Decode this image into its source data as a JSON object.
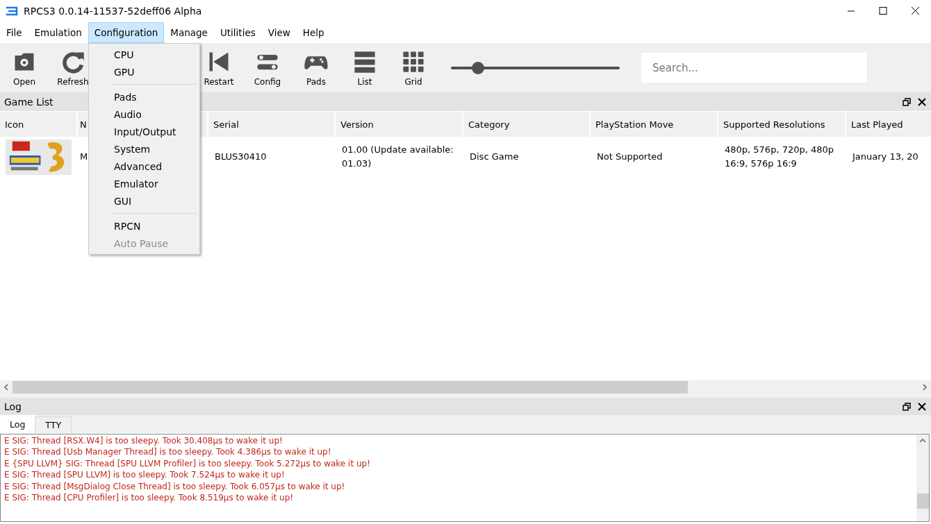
{
  "window": {
    "title": "RPCS3 0.0.14-11537-52deff06 Alpha"
  },
  "menubar": [
    {
      "label": "File",
      "selected": false
    },
    {
      "label": "Emulation",
      "selected": false
    },
    {
      "label": "Configuration",
      "selected": true
    },
    {
      "label": "Manage",
      "selected": false
    },
    {
      "label": "Utilities",
      "selected": false
    },
    {
      "label": "View",
      "selected": false
    },
    {
      "label": "Help",
      "selected": false
    }
  ],
  "toolbar": {
    "left": [
      {
        "label": "Open"
      },
      {
        "label": "Refresh"
      }
    ],
    "right": [
      {
        "label": "Restart"
      },
      {
        "label": "Config"
      },
      {
        "label": "Pads"
      },
      {
        "label": "List"
      },
      {
        "label": "Grid"
      }
    ],
    "zoom": {
      "level": 0.16
    },
    "search": {
      "placeholder": "Search..."
    }
  },
  "game_list": {
    "title": "Game List",
    "columns": [
      "Icon",
      "N",
      "Serial",
      "Version",
      "Category",
      "PlayStation Move",
      "Supported Resolutions",
      "Last Played"
    ],
    "rows": [
      {
        "cells": [
          {
            "kind": "picture"
          },
          {
            "kind": "text",
            "text": "M"
          },
          {
            "kind": "text",
            "text": "BLUS30410"
          },
          {
            "kind": "text",
            "text": "01.00 (Update available: 01.03)"
          },
          {
            "kind": "text",
            "text": "Disc Game"
          },
          {
            "kind": "text",
            "text": "Not Supported"
          },
          {
            "kind": "text",
            "text": "480p, 576p, 720p, 480p 16:9, 576p 16:9"
          },
          {
            "kind": "text",
            "text": "January 13, 20"
          }
        ]
      }
    ]
  },
  "config_menu": [
    {
      "kind": "item",
      "label": "CPU",
      "disabled": false
    },
    {
      "kind": "item",
      "label": "GPU",
      "disabled": false
    },
    {
      "kind": "separator"
    },
    {
      "kind": "item",
      "label": "Pads",
      "disabled": false
    },
    {
      "kind": "item",
      "label": "Audio",
      "disabled": false
    },
    {
      "kind": "item",
      "label": "Input/Output",
      "disabled": false
    },
    {
      "kind": "item",
      "label": "System",
      "disabled": false
    },
    {
      "kind": "item",
      "label": "Advanced",
      "disabled": false
    },
    {
      "kind": "item",
      "label": "Emulator",
      "disabled": false
    },
    {
      "kind": "item",
      "label": "GUI",
      "disabled": false
    },
    {
      "kind": "separator"
    },
    {
      "kind": "item",
      "label": "RPCN",
      "disabled": false
    },
    {
      "kind": "item",
      "label": "Auto Pause",
      "disabled": true
    }
  ],
  "log": {
    "title": "Log",
    "tabs": [
      {
        "label": "Log",
        "selected": true
      },
      {
        "label": "TTY",
        "selected": false
      }
    ],
    "lines": [
      "E SIG: Thread [RSX.W4] is too sleepy. Took 30.408µs to wake it up!",
      "E SIG: Thread [Usb Manager Thread] is too sleepy. Took 4.386µs to wake it up!",
      "E {SPU LLVM} SIG: Thread [SPU LLVM Profiler] is too sleepy. Took 5.272µs to wake it up!",
      "E SIG: Thread [SPU LLVM] is too sleepy. Took 7.524µs to wake it up!",
      "E SIG: Thread [MsgDialog Close Thread] is too sleepy. Took 6.057µs to wake it up!",
      "E SIG: Thread [CPU Profiler] is too sleepy. Took 8.519µs to wake it up!"
    ]
  }
}
